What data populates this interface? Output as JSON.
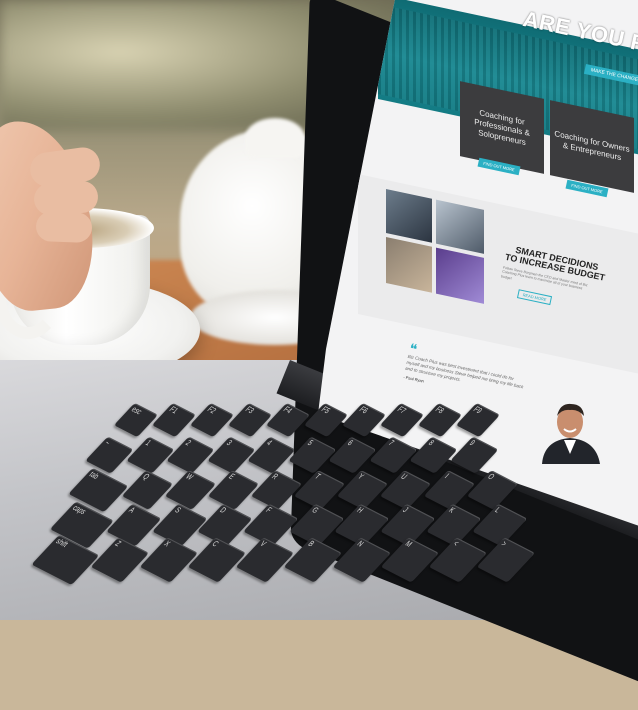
{
  "website": {
    "hero": {
      "title": "ARE YOU READY FO",
      "button": "MAKE THE CHANGE"
    },
    "cards": [
      {
        "label": "Coaching for Professionals & Solopreneurs",
        "button": "FIND OUT MORE"
      },
      {
        "label": "Coaching for Owners & Entrepreneurs",
        "button": "FIND OUT MORE"
      }
    ],
    "feature": {
      "title_line1": "SMART DECIDIONS",
      "title_line2": "TO INCREASE BUDGET",
      "body": "Follow Steve Borgman the CEO and Master mind of Biz Coaching Plus learn to maximize all of your business budget",
      "button": "READ MORE"
    },
    "testimonial": {
      "quote": "Biz Coach Plus was best investment that i could do for myself and my business Steve helped me bring my life back and to structure my projects.",
      "author": "- Paul Ryan"
    }
  },
  "keyboard": {
    "rows": [
      [
        "esc",
        "F1",
        "F2",
        "F3",
        "F4",
        "F5",
        "F6",
        "F7",
        "F8",
        "F9"
      ],
      [
        "~",
        "1",
        "2",
        "3",
        "4",
        "5",
        "6",
        "7",
        "8",
        "9"
      ],
      [
        "tab",
        "Q",
        "W",
        "E",
        "R",
        "T",
        "Y",
        "U",
        "I",
        "O"
      ],
      [
        "caps",
        "A",
        "S",
        "D",
        "F",
        "G",
        "H",
        "J",
        "K",
        "L"
      ],
      [
        "shift",
        "Z",
        "X",
        "C",
        "V",
        "B",
        "N",
        "M",
        "<",
        ">"
      ]
    ]
  },
  "colors": {
    "accent": "#2bb0c4",
    "hero": "#137b84",
    "card": "#3c3c3e"
  }
}
